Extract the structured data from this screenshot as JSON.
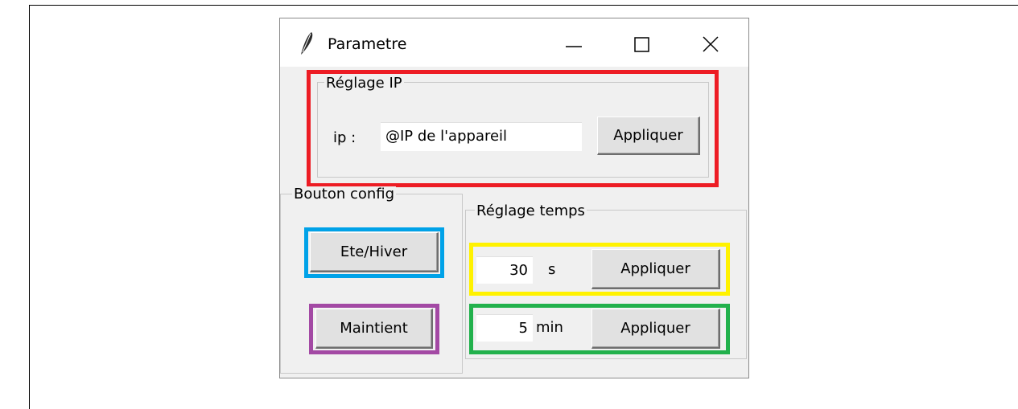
{
  "window": {
    "title": "Parametre",
    "icon": "feather-icon",
    "controls": [
      "minimize-icon",
      "maximize-icon",
      "close-icon"
    ]
  },
  "ip_group": {
    "legend": "Réglage IP",
    "label": "ip :",
    "input_value": "@IP de l'appareil",
    "apply_label": "Appliquer"
  },
  "config_group": {
    "legend": "Bouton config",
    "season_label": "Ete/Hiver",
    "hold_label": "Maintient"
  },
  "time_group": {
    "legend": "Réglage temps",
    "seconds_value": "30",
    "seconds_unit": "s",
    "seconds_apply": "Appliquer",
    "minutes_value": "5",
    "minutes_unit": "min",
    "minutes_apply": "Appliquer"
  },
  "highlight_colors": {
    "ip": "#ed1c24",
    "season": "#00a2e8",
    "hold": "#a349a4",
    "seconds": "#fff200",
    "minutes": "#22b14c"
  }
}
